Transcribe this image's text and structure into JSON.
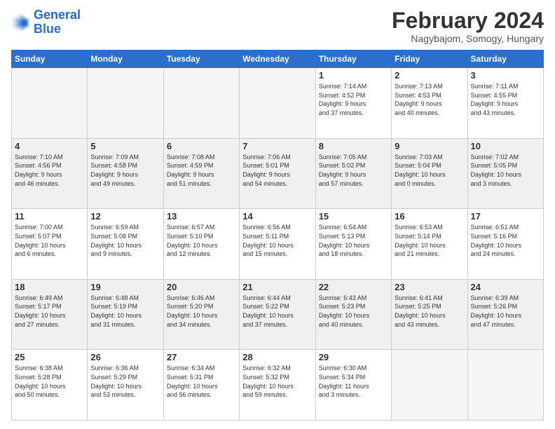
{
  "logo": {
    "line1": "General",
    "line2": "Blue"
  },
  "calendar": {
    "title": "February 2024",
    "subtitle": "Nagybajom, Somogy, Hungary",
    "days_header": [
      "Sunday",
      "Monday",
      "Tuesday",
      "Wednesday",
      "Thursday",
      "Friday",
      "Saturday"
    ],
    "weeks": [
      {
        "shade": false,
        "days": [
          {
            "number": "",
            "info": ""
          },
          {
            "number": "",
            "info": ""
          },
          {
            "number": "",
            "info": ""
          },
          {
            "number": "",
            "info": ""
          },
          {
            "number": "1",
            "info": "Sunrise: 7:14 AM\nSunset: 4:52 PM\nDaylight: 9 hours\nand 37 minutes."
          },
          {
            "number": "2",
            "info": "Sunrise: 7:13 AM\nSunset: 4:53 PM\nDaylight: 9 hours\nand 40 minutes."
          },
          {
            "number": "3",
            "info": "Sunrise: 7:11 AM\nSunset: 4:55 PM\nDaylight: 9 hours\nand 43 minutes."
          }
        ]
      },
      {
        "shade": true,
        "days": [
          {
            "number": "4",
            "info": "Sunrise: 7:10 AM\nSunset: 4:56 PM\nDaylight: 9 hours\nand 46 minutes."
          },
          {
            "number": "5",
            "info": "Sunrise: 7:09 AM\nSunset: 4:58 PM\nDaylight: 9 hours\nand 49 minutes."
          },
          {
            "number": "6",
            "info": "Sunrise: 7:08 AM\nSunset: 4:59 PM\nDaylight: 9 hours\nand 51 minutes."
          },
          {
            "number": "7",
            "info": "Sunrise: 7:06 AM\nSunset: 5:01 PM\nDaylight: 9 hours\nand 54 minutes."
          },
          {
            "number": "8",
            "info": "Sunrise: 7:05 AM\nSunset: 5:02 PM\nDaylight: 9 hours\nand 57 minutes."
          },
          {
            "number": "9",
            "info": "Sunrise: 7:03 AM\nSunset: 5:04 PM\nDaylight: 10 hours\nand 0 minutes."
          },
          {
            "number": "10",
            "info": "Sunrise: 7:02 AM\nSunset: 5:05 PM\nDaylight: 10 hours\nand 3 minutes."
          }
        ]
      },
      {
        "shade": false,
        "days": [
          {
            "number": "11",
            "info": "Sunrise: 7:00 AM\nSunset: 5:07 PM\nDaylight: 10 hours\nand 6 minutes."
          },
          {
            "number": "12",
            "info": "Sunrise: 6:59 AM\nSunset: 5:08 PM\nDaylight: 10 hours\nand 9 minutes."
          },
          {
            "number": "13",
            "info": "Sunrise: 6:57 AM\nSunset: 5:10 PM\nDaylight: 10 hours\nand 12 minutes."
          },
          {
            "number": "14",
            "info": "Sunrise: 6:56 AM\nSunset: 5:11 PM\nDaylight: 10 hours\nand 15 minutes."
          },
          {
            "number": "15",
            "info": "Sunrise: 6:54 AM\nSunset: 5:13 PM\nDaylight: 10 hours\nand 18 minutes."
          },
          {
            "number": "16",
            "info": "Sunrise: 6:53 AM\nSunset: 5:14 PM\nDaylight: 10 hours\nand 21 minutes."
          },
          {
            "number": "17",
            "info": "Sunrise: 6:51 AM\nSunset: 5:16 PM\nDaylight: 10 hours\nand 24 minutes."
          }
        ]
      },
      {
        "shade": true,
        "days": [
          {
            "number": "18",
            "info": "Sunrise: 6:49 AM\nSunset: 5:17 PM\nDaylight: 10 hours\nand 27 minutes."
          },
          {
            "number": "19",
            "info": "Sunrise: 6:48 AM\nSunset: 5:19 PM\nDaylight: 10 hours\nand 31 minutes."
          },
          {
            "number": "20",
            "info": "Sunrise: 6:46 AM\nSunset: 5:20 PM\nDaylight: 10 hours\nand 34 minutes."
          },
          {
            "number": "21",
            "info": "Sunrise: 6:44 AM\nSunset: 5:22 PM\nDaylight: 10 hours\nand 37 minutes."
          },
          {
            "number": "22",
            "info": "Sunrise: 6:43 AM\nSunset: 5:23 PM\nDaylight: 10 hours\nand 40 minutes."
          },
          {
            "number": "23",
            "info": "Sunrise: 6:41 AM\nSunset: 5:25 PM\nDaylight: 10 hours\nand 43 minutes."
          },
          {
            "number": "24",
            "info": "Sunrise: 6:39 AM\nSunset: 5:26 PM\nDaylight: 10 hours\nand 47 minutes."
          }
        ]
      },
      {
        "shade": false,
        "days": [
          {
            "number": "25",
            "info": "Sunrise: 6:38 AM\nSunset: 5:28 PM\nDaylight: 10 hours\nand 50 minutes."
          },
          {
            "number": "26",
            "info": "Sunrise: 6:36 AM\nSunset: 5:29 PM\nDaylight: 10 hours\nand 53 minutes."
          },
          {
            "number": "27",
            "info": "Sunrise: 6:34 AM\nSunset: 5:31 PM\nDaylight: 10 hours\nand 56 minutes."
          },
          {
            "number": "28",
            "info": "Sunrise: 6:32 AM\nSunset: 5:32 PM\nDaylight: 10 hours\nand 59 minutes."
          },
          {
            "number": "29",
            "info": "Sunrise: 6:30 AM\nSunset: 5:34 PM\nDaylight: 11 hours\nand 3 minutes."
          },
          {
            "number": "",
            "info": ""
          },
          {
            "number": "",
            "info": ""
          }
        ]
      }
    ]
  }
}
